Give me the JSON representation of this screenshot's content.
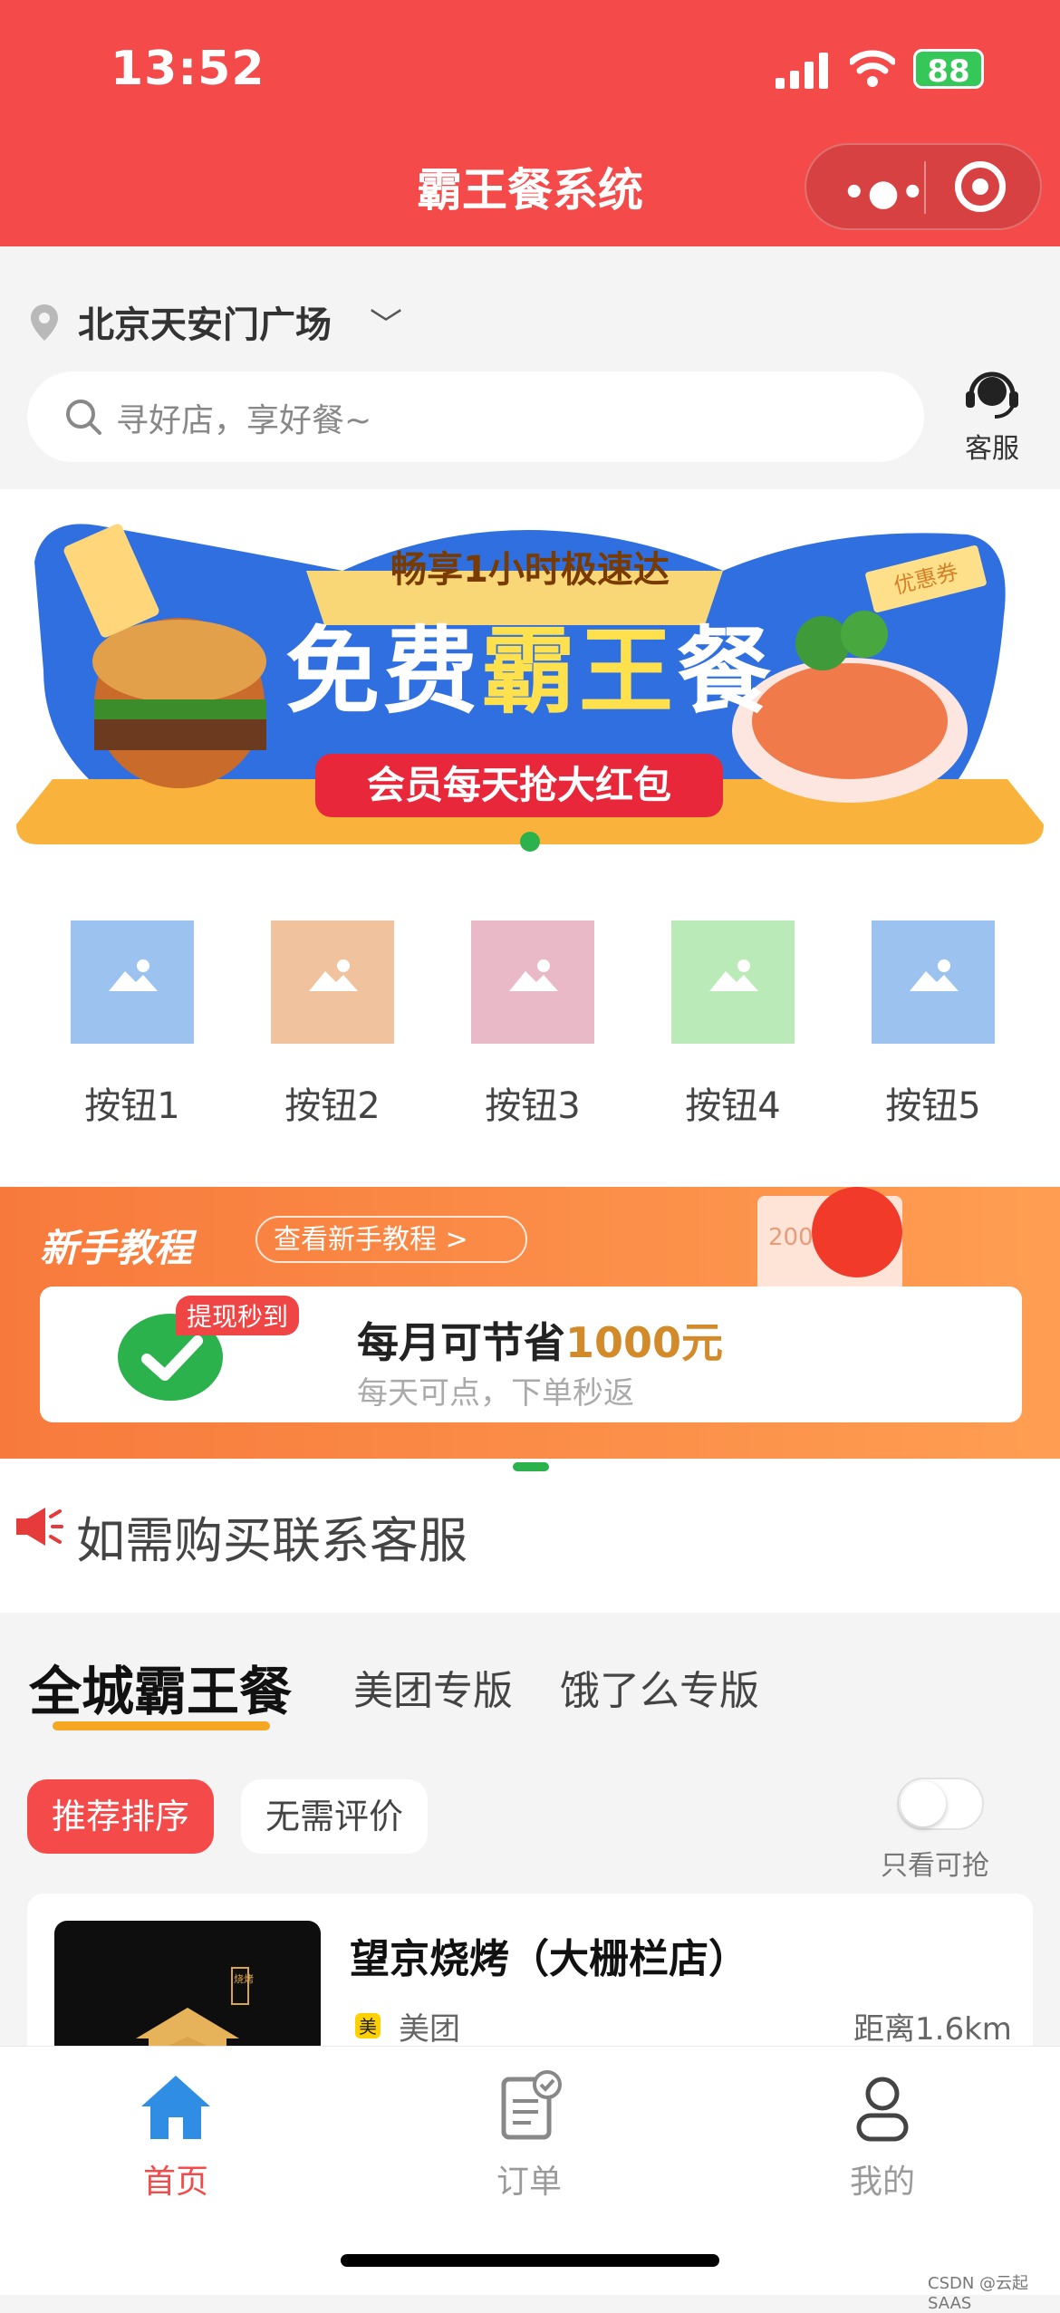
{
  "status": {
    "time": "13:52",
    "battery": "88"
  },
  "nav": {
    "title": "霸王餐系统"
  },
  "location": {
    "name": "北京天安门广场",
    "chevron": "﹀"
  },
  "search": {
    "placeholder": "寻好店，享好餐~"
  },
  "service": {
    "label": "客服"
  },
  "banner": {
    "top_text": "畅享1小时极速达",
    "main_text_a": "免费",
    "main_text_b": "霸王",
    "main_text_c": "餐",
    "sub_text": "会员每天抢大红包",
    "coupon": "优惠券"
  },
  "grid": [
    {
      "label": "按钮1",
      "color": "#9cc3ef"
    },
    {
      "label": "按钮2",
      "color": "#f0c29e"
    },
    {
      "label": "按钮3",
      "color": "#e9b9c7"
    },
    {
      "label": "按钮4",
      "color": "#b9eab7"
    },
    {
      "label": "按钮5",
      "color": "#9cc3ef"
    }
  ],
  "promo": {
    "title": "新手教程",
    "guide_button": "查看新手教程 >",
    "tag": "提现秒到",
    "main_a": "每月可节省",
    "main_num": "1000元",
    "sub": "每天可点，下单秒返",
    "deco_num": "200"
  },
  "notice": {
    "text": "如需购买联系客服"
  },
  "tabs": [
    "全城霸王餐",
    "美团专版",
    "饿了么专版"
  ],
  "filters": {
    "active": "推荐排序",
    "inactive": "无需评价",
    "toggle_label": "只看可抢",
    "toggle_on": false
  },
  "shop": {
    "name": "望京烧烤（大栅栏店）",
    "platform": "美团",
    "distance": "距离1.6km",
    "image_badge": "烧烤"
  },
  "tabbar": [
    {
      "label": "首页",
      "icon": "home-icon",
      "active": true
    },
    {
      "label": "订单",
      "icon": "order-icon",
      "active": false
    },
    {
      "label": "我的",
      "icon": "profile-icon",
      "active": false
    }
  ],
  "colors": {
    "brand": "#f54a4a",
    "accent": "#f5a623",
    "active_tab": "#2f8de4",
    "green": "#2bb24c"
  },
  "watermark": "CSDN @云起SAAS"
}
